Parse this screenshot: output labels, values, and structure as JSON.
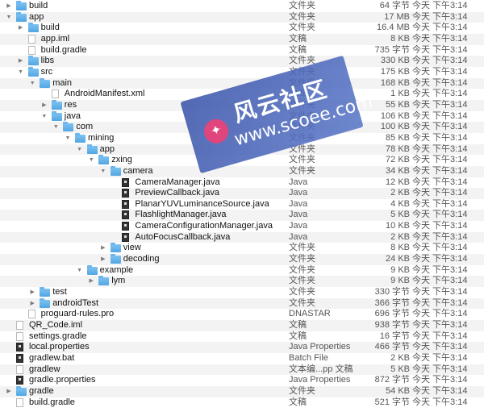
{
  "rows": [
    {
      "indent": 0,
      "disclosure": "right",
      "icon": "folder",
      "name": "build",
      "kind": "文件夹",
      "size": "64 字节",
      "date": "今天 下午3:14"
    },
    {
      "indent": 0,
      "disclosure": "down",
      "icon": "folder",
      "name": "app",
      "kind": "文件夹",
      "size": "17 MB",
      "date": "今天 下午3:14"
    },
    {
      "indent": 1,
      "disclosure": "right",
      "icon": "folder",
      "name": "build",
      "kind": "文件夹",
      "size": "16.4 MB",
      "date": "今天 下午3:14"
    },
    {
      "indent": 1,
      "disclosure": "none",
      "icon": "file",
      "name": "app.iml",
      "kind": "文稿",
      "size": "8 KB",
      "date": "今天 下午3:14"
    },
    {
      "indent": 1,
      "disclosure": "none",
      "icon": "file",
      "name": "build.gradle",
      "kind": "文稿",
      "size": "735 字节",
      "date": "今天 下午3:14"
    },
    {
      "indent": 1,
      "disclosure": "right",
      "icon": "folder",
      "name": "libs",
      "kind": "文件夹",
      "size": "330 KB",
      "date": "今天 下午3:14"
    },
    {
      "indent": 1,
      "disclosure": "down",
      "icon": "folder",
      "name": "src",
      "kind": "文件夹",
      "size": "175 KB",
      "date": "今天 下午3:14"
    },
    {
      "indent": 2,
      "disclosure": "down",
      "icon": "folder",
      "name": "main",
      "kind": "文件夹",
      "size": "168 KB",
      "date": "今天 下午3:14"
    },
    {
      "indent": 3,
      "disclosure": "none",
      "icon": "file",
      "name": "AndroidManifest.xml",
      "kind": "XML",
      "size": "1 KB",
      "date": "今天 下午3:14"
    },
    {
      "indent": 3,
      "disclosure": "right",
      "icon": "folder",
      "name": "res",
      "kind": "文件夹",
      "size": "55 KB",
      "date": "今天 下午3:14"
    },
    {
      "indent": 3,
      "disclosure": "down",
      "icon": "folder",
      "name": "java",
      "kind": "文件夹",
      "size": "106 KB",
      "date": "今天 下午3:14"
    },
    {
      "indent": 4,
      "disclosure": "down",
      "icon": "folder",
      "name": "com",
      "kind": "文件夹",
      "size": "100 KB",
      "date": "今天 下午3:14"
    },
    {
      "indent": 5,
      "disclosure": "down",
      "icon": "folder",
      "name": "mining",
      "kind": "文件夹",
      "size": "85 KB",
      "date": "今天 下午3:14"
    },
    {
      "indent": 6,
      "disclosure": "down",
      "icon": "folder",
      "name": "app",
      "kind": "文件夹",
      "size": "78 KB",
      "date": "今天 下午3:14"
    },
    {
      "indent": 7,
      "disclosure": "down",
      "icon": "folder",
      "name": "zxing",
      "kind": "文件夹",
      "size": "72 KB",
      "date": "今天 下午3:14"
    },
    {
      "indent": 8,
      "disclosure": "down",
      "icon": "folder",
      "name": "camera",
      "kind": "文件夹",
      "size": "34 KB",
      "date": "今天 下午3:14"
    },
    {
      "indent": 9,
      "disclosure": "none",
      "icon": "java",
      "name": "CameraManager.java",
      "kind": "Java",
      "size": "12 KB",
      "date": "今天 下午3:14"
    },
    {
      "indent": 9,
      "disclosure": "none",
      "icon": "java",
      "name": "PreviewCallback.java",
      "kind": "Java",
      "size": "2 KB",
      "date": "今天 下午3:14"
    },
    {
      "indent": 9,
      "disclosure": "none",
      "icon": "java",
      "name": "PlanarYUVLuminanceSource.java",
      "kind": "Java",
      "size": "4 KB",
      "date": "今天 下午3:14"
    },
    {
      "indent": 9,
      "disclosure": "none",
      "icon": "java",
      "name": "FlashlightManager.java",
      "kind": "Java",
      "size": "5 KB",
      "date": "今天 下午3:14"
    },
    {
      "indent": 9,
      "disclosure": "none",
      "icon": "java",
      "name": "CameraConfigurationManager.java",
      "kind": "Java",
      "size": "10 KB",
      "date": "今天 下午3:14"
    },
    {
      "indent": 9,
      "disclosure": "none",
      "icon": "java",
      "name": "AutoFocusCallback.java",
      "kind": "Java",
      "size": "2 KB",
      "date": "今天 下午3:14"
    },
    {
      "indent": 8,
      "disclosure": "right",
      "icon": "folder",
      "name": "view",
      "kind": "文件夹",
      "size": "8 KB",
      "date": "今天 下午3:14"
    },
    {
      "indent": 8,
      "disclosure": "right",
      "icon": "folder",
      "name": "decoding",
      "kind": "文件夹",
      "size": "24 KB",
      "date": "今天 下午3:14"
    },
    {
      "indent": 6,
      "disclosure": "down",
      "icon": "folder",
      "name": "example",
      "kind": "文件夹",
      "size": "9 KB",
      "date": "今天 下午3:14"
    },
    {
      "indent": 7,
      "disclosure": "right",
      "icon": "folder",
      "name": "lym",
      "kind": "文件夹",
      "size": "9 KB",
      "date": "今天 下午3:14"
    },
    {
      "indent": 2,
      "disclosure": "right",
      "icon": "folder",
      "name": "test",
      "kind": "文件夹",
      "size": "330 字节",
      "date": "今天 下午3:14"
    },
    {
      "indent": 2,
      "disclosure": "right",
      "icon": "folder",
      "name": "androidTest",
      "kind": "文件夹",
      "size": "366 字节",
      "date": "今天 下午3:14"
    },
    {
      "indent": 1,
      "disclosure": "none",
      "icon": "file",
      "name": "proguard-rules.pro",
      "kind": "DNASTAR",
      "size": "696 字节",
      "date": "今天 下午3:14"
    },
    {
      "indent": 0,
      "disclosure": "none",
      "icon": "file",
      "name": "QR_Code.iml",
      "kind": "文稿",
      "size": "938 字节",
      "date": "今天 下午3:14"
    },
    {
      "indent": 0,
      "disclosure": "none",
      "icon": "file",
      "name": "settings.gradle",
      "kind": "文稿",
      "size": "16 字节",
      "date": "今天 下午3:14"
    },
    {
      "indent": 0,
      "disclosure": "none",
      "icon": "java",
      "name": "local.properties",
      "kind": "Java Properties",
      "size": "466 字节",
      "date": "今天 下午3:14"
    },
    {
      "indent": 0,
      "disclosure": "none",
      "icon": "java",
      "name": "gradlew.bat",
      "kind": "Batch File",
      "size": "2 KB",
      "date": "今天 下午3:14"
    },
    {
      "indent": 0,
      "disclosure": "none",
      "icon": "file",
      "name": "gradlew",
      "kind": "文本编...pp 文稿",
      "size": "5 KB",
      "date": "今天 下午3:14"
    },
    {
      "indent": 0,
      "disclosure": "none",
      "icon": "java",
      "name": "gradle.properties",
      "kind": "Java Properties",
      "size": "872 字节",
      "date": "今天 下午3:14"
    },
    {
      "indent": 0,
      "disclosure": "right",
      "icon": "folder",
      "name": "gradle",
      "kind": "文件夹",
      "size": "54 KB",
      "date": "今天 下午3:14"
    },
    {
      "indent": 0,
      "disclosure": "none",
      "icon": "file",
      "name": "build.gradle",
      "kind": "文稿",
      "size": "521 字节",
      "date": "今天 下午3:14"
    }
  ],
  "watermark": {
    "title": "风云社区",
    "url": "www.scoee.com",
    "logo_icon": "bird-logo-icon"
  }
}
